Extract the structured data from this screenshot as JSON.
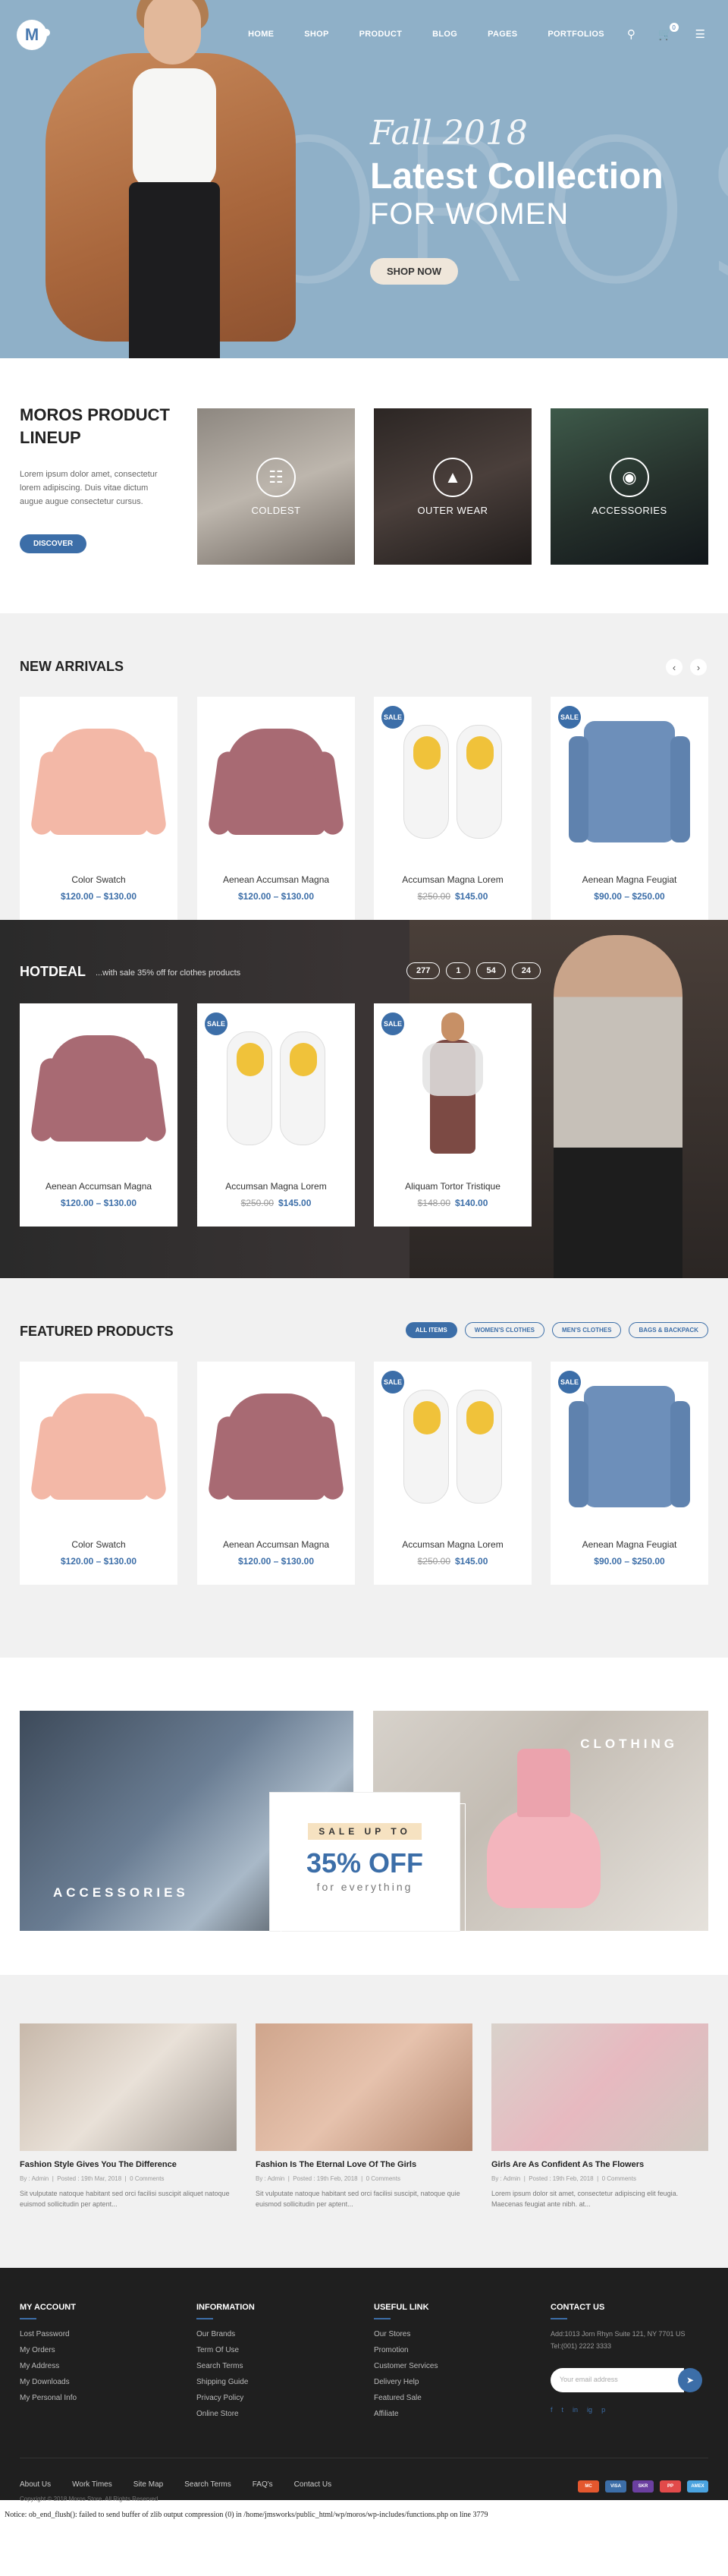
{
  "nav": {
    "logo": "M",
    "items": [
      "HOME",
      "SHOP",
      "PRODUCT",
      "BLOG",
      "PAGES",
      "PORTFOLIOS"
    ],
    "cart_count": "0"
  },
  "hero": {
    "bg_text": "MOROS",
    "script": "Fall 2018",
    "title": "Latest Collection",
    "subtitle": "FOR WOMEN",
    "button": "SHOP NOW"
  },
  "lineup": {
    "title": "MOROS PRODUCT LINEUP",
    "text": "Lorem ipsum dolor amet, consectetur lorem adipiscing. Duis vitae dictum augue augue consectetur cursus.",
    "button": "DISCOVER",
    "categories": [
      {
        "label": "COLDEST",
        "icon": "coat-icon",
        "color": "#9a958d"
      },
      {
        "label": "OUTER WEAR",
        "icon": "jacket-icon",
        "color": "#3b3533"
      },
      {
        "label": "ACCESSORIES",
        "icon": "bag-icon",
        "color": "#2f3a34"
      }
    ]
  },
  "arrivals": {
    "title": "NEW ARRIVALS",
    "products": [
      {
        "name": "Color Swatch",
        "price": "$120.00 – $130.00",
        "old": "",
        "sale": false,
        "art": "pink-sweater"
      },
      {
        "name": "Aenean Accumsan Magna",
        "price": "$120.00 – $130.00",
        "old": "",
        "sale": false,
        "art": "mauve-sweater"
      },
      {
        "name": "Accumsan Magna Lorem",
        "price": "$145.00",
        "old": "$250.00",
        "sale": true,
        "art": "sneakers"
      },
      {
        "name": "Aenean Magna Feugiat",
        "price": "$90.00 – $250.00",
        "old": "",
        "sale": true,
        "art": "denim-shirt"
      }
    ]
  },
  "hotdeal": {
    "title": "HOTDEAL",
    "subtitle": "...with sale 35% off for clothes products",
    "countdown": [
      "277",
      "1",
      "54",
      "24"
    ],
    "products": [
      {
        "name": "Aenean Accumsan Magna",
        "price": "$120.00 – $130.00",
        "old": "",
        "sale": false
      },
      {
        "name": "Accumsan Magna Lorem",
        "price": "$145.00",
        "old": "$250.00",
        "sale": true
      },
      {
        "name": "Aliquam Tortor Tristique",
        "price": "$140.00",
        "old": "$148.00",
        "sale": true
      }
    ]
  },
  "featured": {
    "title": "FEATURED PRODUCTS",
    "filters": [
      "ALL ITEMS",
      "WOMEN'S CLOTHES",
      "MEN'S CLOTHES",
      "BAGS & BACKPACK"
    ],
    "products": [
      {
        "name": "Color Swatch",
        "price": "$120.00 – $130.00",
        "old": "",
        "sale": false
      },
      {
        "name": "Aenean Accumsan Magna",
        "price": "$120.00 – $130.00",
        "old": "",
        "sale": false
      },
      {
        "name": "Accumsan Magna Lorem",
        "price": "$145.00",
        "old": "$250.00",
        "sale": true
      },
      {
        "name": "Aenean Magna Feugiat",
        "price": "$90.00 – $250.00",
        "old": "",
        "sale": true
      }
    ]
  },
  "banners": {
    "left_label": "ACCESSORIES",
    "right_label": "CLOTHING",
    "promo_upto": "SALE UP TO",
    "promo_pct": "35% OFF",
    "promo_for": "for everything"
  },
  "blog": {
    "posts": [
      {
        "title": "Fashion Style Gives You The Difference",
        "author": "By : Admin",
        "date": "Posted : 19th Mar, 2018",
        "comments": "0 Comments",
        "excerpt": "Sit vulputate natoque habitant sed orci facilisi suscipit aliquet natoque euismod sollicitudin per aptent..."
      },
      {
        "title": "Fashion Is The Eternal Love Of The Girls",
        "author": "By : Admin",
        "date": "Posted : 19th Feb, 2018",
        "comments": "0 Comments",
        "excerpt": "Sit vulputate natoque habitant sed orci facilisi suscipit, natoque quie euismod sollicitudin per aptent..."
      },
      {
        "title": "Girls Are As Confident As The Flowers",
        "author": "By : Admin",
        "date": "Posted : 19th Feb, 2018",
        "comments": "0 Comments",
        "excerpt": "Lorem ipsum dolor sit amet, consectetur adipiscing elit feugia. Maecenas feugiat ante nibh. at..."
      }
    ]
  },
  "footer": {
    "account_title": "MY ACCOUNT",
    "account_links": [
      "Lost Password",
      "My Orders",
      "My Address",
      "My Downloads",
      "My Personal Info"
    ],
    "info_title": "INFORMATION",
    "info_links": [
      "Our Brands",
      "Term Of Use",
      "Search Terms",
      "Shipping Guide",
      "Privacy Policy",
      "Online Store"
    ],
    "useful_title": "USEFUL LINK",
    "useful_links": [
      "Our Stores",
      "Promotion",
      "Customer Services",
      "Delivery Help",
      "Featured Sale",
      "Affiliate"
    ],
    "contact_title": "CONTACT US",
    "address": "Add:1013 Jorn Rhyn Suite 121, NY 7701 US",
    "phone": "Tel:(001) 2222 3333",
    "email_placeholder": "Your email address",
    "socials": [
      "f",
      "t",
      "in",
      "ig",
      "p"
    ],
    "bottom_links": [
      "About Us",
      "Work Times",
      "Site Map",
      "Search Terms",
      "FAQ's",
      "Contact Us"
    ],
    "copyright": "Copyright © 2018 Moros Store. All Rights Reserved",
    "payments": [
      {
        "name": "MC",
        "color": "#e4572e"
      },
      {
        "name": "VISA",
        "color": "#3c6ea8"
      },
      {
        "name": "SKR",
        "color": "#6b3fa0"
      },
      {
        "name": "PP",
        "color": "#e24a4a"
      },
      {
        "name": "AMEX",
        "color": "#4aa3df"
      }
    ]
  },
  "notice": "Notice: ob_end_flush(): failed to send buffer of zlib output compression (0) in /home/jmsworks/public_html/wp/moros/wp-includes/functions.php on line 3779"
}
